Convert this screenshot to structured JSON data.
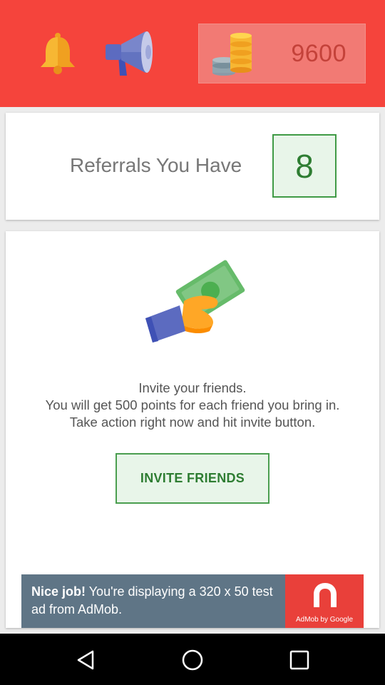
{
  "header": {
    "points": "9600",
    "icons": {
      "notifications": "bell-icon",
      "announcements": "megaphone-icon",
      "coins": "coins-icon"
    },
    "colors": {
      "background": "#f5443c",
      "points_box": "#f27a74"
    }
  },
  "referrals": {
    "label": "Referrals You Have",
    "count": "8"
  },
  "invite": {
    "illustration": "hand-with-money-icon",
    "line1": "Invite your friends.",
    "line2": "You will get 500 points for each friend you bring in.",
    "line3": "Take action right now and hit invite button.",
    "button_label": "INVITE FRIENDS",
    "accent_color": "#2e7d32"
  },
  "ad": {
    "headline": "Nice job!",
    "body": "You're displaying a 320 x 50 test ad from AdMob.",
    "caption": "AdMob by Google"
  },
  "navigation": {
    "back": "back-triangle-icon",
    "home": "home-circle-icon",
    "recents": "recents-square-icon"
  }
}
